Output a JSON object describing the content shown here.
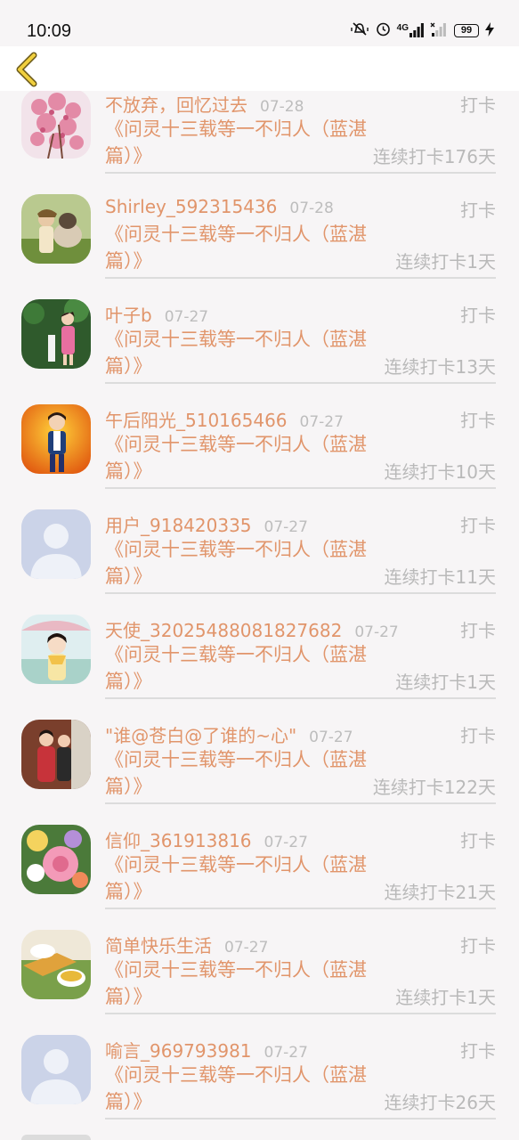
{
  "status_bar": {
    "time": "10:09",
    "signal": "4G",
    "battery": "99"
  },
  "colors": {
    "accent": "#e1956b",
    "muted": "#b9b9b9",
    "back_arrow": "#e6c23a"
  },
  "list": {
    "items": [
      {
        "name": "不放弃，回忆过去",
        "date": "07-28",
        "checkin": "打卡",
        "book": "《问灵十三载等一不归人（蓝湛篇）》",
        "streak": "连续打卡176天",
        "avatar": "pink-blossom"
      },
      {
        "name": "Shirley_592315436",
        "date": "07-28",
        "checkin": "打卡",
        "book": "《问灵十三载等一不归人（蓝湛篇）》",
        "streak": "连续打卡1天",
        "avatar": "girl-with-dog"
      },
      {
        "name": "叶子b",
        "date": "07-27",
        "checkin": "打卡",
        "book": "《问灵十三载等一不归人（蓝湛篇）》",
        "streak": "连续打卡13天",
        "avatar": "girl-in-garden"
      },
      {
        "name": "午后阳光_510165466",
        "date": "07-27",
        "checkin": "打卡",
        "book": "《问灵十三载等一不归人（蓝湛篇）》",
        "streak": "连续打卡10天",
        "avatar": "child-orange"
      },
      {
        "name": "用户_918420335",
        "date": "07-27",
        "checkin": "打卡",
        "book": "《问灵十三载等一不归人（蓝湛篇）》",
        "streak": "连续打卡11天",
        "avatar": "default-person"
      },
      {
        "name": "天使_32025488081827682",
        "date": "07-27",
        "checkin": "打卡",
        "book": "《问灵十三载等一不归人（蓝湛篇）》",
        "streak": "连续打卡1天",
        "avatar": "girl-umbrella"
      },
      {
        "name": "\"谁@苍白@了谁的~心\"",
        "date": "07-27",
        "checkin": "打卡",
        "book": "《问灵十三载等一不归人（蓝湛篇）》",
        "streak": "连续打卡122天",
        "avatar": "two-kids"
      },
      {
        "name": "信仰_361913816",
        "date": "07-27",
        "checkin": "打卡",
        "book": "《问灵十三载等一不归人（蓝湛篇）》",
        "streak": "连续打卡21天",
        "avatar": "flowers"
      },
      {
        "name": "简单快乐生活",
        "date": "07-27",
        "checkin": "打卡",
        "book": "《问灵十三载等一不归人（蓝湛篇）》",
        "streak": "连续打卡1天",
        "avatar": "tea-cup"
      },
      {
        "name": "喻言_969793981",
        "date": "07-27",
        "checkin": "打卡",
        "book": "《问灵十三载等一不归人（蓝湛篇）》",
        "streak": "连续打卡26天",
        "avatar": "default-person"
      }
    ]
  }
}
